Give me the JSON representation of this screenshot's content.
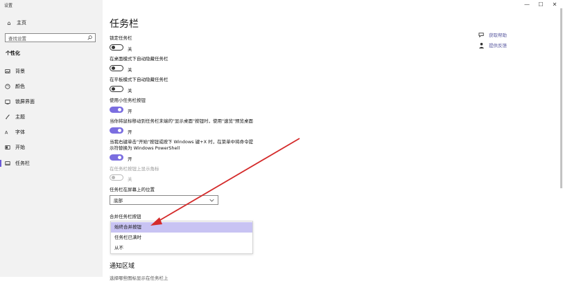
{
  "app": {
    "title": "设置"
  },
  "window_controls": {
    "minimize": "—",
    "maximize": "☐",
    "close": "✕"
  },
  "sidebar": {
    "home": {
      "label": "主页",
      "icon": "home-icon"
    },
    "search": {
      "placeholder": "查找设置",
      "icon": "search-icon"
    },
    "section": "个性化",
    "items": [
      {
        "label": "背景",
        "icon": "picture-icon"
      },
      {
        "label": "颜色",
        "icon": "palette-icon"
      },
      {
        "label": "锁屏界面",
        "icon": "lock-screen-icon"
      },
      {
        "label": "主题",
        "icon": "theme-brush-icon"
      },
      {
        "label": "字体",
        "icon": "font-icon"
      },
      {
        "label": "开始",
        "icon": "start-icon"
      },
      {
        "label": "任务栏",
        "icon": "taskbar-icon",
        "active": true
      }
    ]
  },
  "main": {
    "title": "任务栏",
    "settings": [
      {
        "label": "锁定任务栏",
        "state": "关",
        "on": false
      },
      {
        "label": "在桌面模式下自动隐藏任务栏",
        "state": "关",
        "on": false
      },
      {
        "label": "在平板模式下自动隐藏任务栏",
        "state": "关",
        "on": false
      },
      {
        "label": "使用小任务栏按钮",
        "state": "开",
        "on": true
      },
      {
        "label": "当你将鼠标移动到任务栏末端的\"显示桌面\"按钮时，使用\"速览\"预览桌面",
        "state": "开",
        "on": true
      },
      {
        "label_line1": "当我右键单击\"开始\"按钮或按下 Windows 键+X 时，在菜单中将命令提",
        "label_line2": "示符替换为 Windows PowerShell",
        "state": "开",
        "on": true
      },
      {
        "label": "在任务栏按钮上显示角标",
        "state": "关",
        "on": false,
        "disabled": true
      }
    ],
    "position": {
      "label": "任务栏在屏幕上的位置",
      "value": "底部"
    },
    "combine": {
      "label": "合并任务栏按钮",
      "options": [
        "始终合并按钮",
        "任务栏已满时",
        "从不"
      ],
      "selected": "始终合并按钮"
    },
    "notification_title": "通知区域",
    "cut_text": "选择哪些图标显示在任务栏上"
  },
  "help": {
    "get_help": "获取帮助",
    "feedback": "提供反馈"
  },
  "colors": {
    "accent": "#7b6ee0",
    "selected_option": "#c8c3f3",
    "arrow": "#d42a2a"
  }
}
